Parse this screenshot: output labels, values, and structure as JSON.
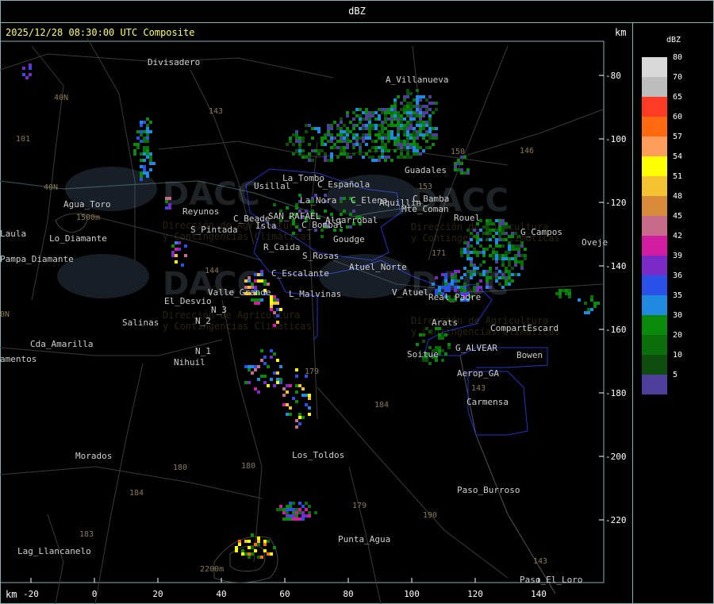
{
  "header": {
    "title": "dBZ"
  },
  "radar": {
    "timestamp": "2025/12/28 08:30:00 UTC Composite",
    "unit_top": "km",
    "unit_bottom": "km"
  },
  "legend": {
    "title": "dBZ",
    "levels": [
      {
        "v": "80",
        "c": "#d9d9d9"
      },
      {
        "v": "70",
        "c": "#bdbdbd"
      },
      {
        "v": "65",
        "c": "#ff3b26"
      },
      {
        "v": "60",
        "c": "#ff6a10"
      },
      {
        "v": "57",
        "c": "#ff9d5c"
      },
      {
        "v": "54",
        "c": "#ffff00"
      },
      {
        "v": "51",
        "c": "#f5c332"
      },
      {
        "v": "48",
        "c": "#d98a3a"
      },
      {
        "v": "45",
        "c": "#c86a8a"
      },
      {
        "v": "42",
        "c": "#d21ca2"
      },
      {
        "v": "39",
        "c": "#7a2bc7"
      },
      {
        "v": "36",
        "c": "#2a50e8"
      },
      {
        "v": "35",
        "c": "#1f8ae0"
      },
      {
        "v": "30",
        "c": "#0a8a0a"
      },
      {
        "v": "20",
        "c": "#0a6e0a"
      },
      {
        "v": "10",
        "c": "#0f4d0f"
      },
      {
        "v": "5",
        "c": "#4f3f9c"
      }
    ]
  },
  "axes": {
    "y_ticks": [
      "-80",
      "-100",
      "-120",
      "-140",
      "-160",
      "-180",
      "-200",
      "-220"
    ],
    "x_ticks": [
      "-20",
      "0",
      "20",
      "40",
      "60",
      "80",
      "100",
      "120",
      "140"
    ]
  },
  "watermark": {
    "brand": "DACC",
    "line1": "Dirección de Agricultura",
    "line2": "y Contingencias Climáticas"
  },
  "places": [
    "Divisadero",
    "A_Villanueva",
    "Guadales",
    "La_Tombo",
    "C_Española",
    "Usillal",
    "La_Nora",
    "C_Elena",
    "Aquillin",
    "C_Bamba",
    "Mte_Coman",
    "Rouel",
    "G_Campos",
    "Oveje",
    "S_Pintada",
    "Reyunos",
    "C_Beade",
    "SAN_RAFAEL",
    "Algarrobal",
    "C_Bombal",
    "Pampa_Diamante",
    "Agua_Toro",
    "R_Caida",
    "Goudge",
    "S_Rosas",
    "Atuel_Norte",
    "C_Escalante",
    "L_Malvinas",
    "V_Atuel",
    "El_Desvio",
    "Valle_Grande",
    "Real_Padre",
    "Salinas",
    "N_2",
    "N_3",
    "Arats",
    "CompartEscard",
    "Cda_Amarilla",
    "N_1",
    "Nihuil",
    "Soitue",
    "G_ALVEAR",
    "Bowen",
    "amentos",
    "Aerop_GA",
    "Carmensa",
    "Morados",
    "Los_Toldos",
    "Paso_Burroso",
    "Punta_Agua",
    "Lag_Llancanelo",
    "Paso_El_Loro",
    "Laula",
    "Lo_Diamante"
  ],
  "roads": [
    "40N",
    "101",
    "143",
    "40N",
    "153",
    "146",
    "144",
    "180",
    "171",
    "179",
    "184",
    "180",
    "184",
    "183",
    "179",
    "190",
    "143",
    "150",
    "143",
    "0N",
    "1500m",
    "2200m"
  ],
  "ref_labels": [
    "Lob",
    "Isla"
  ]
}
